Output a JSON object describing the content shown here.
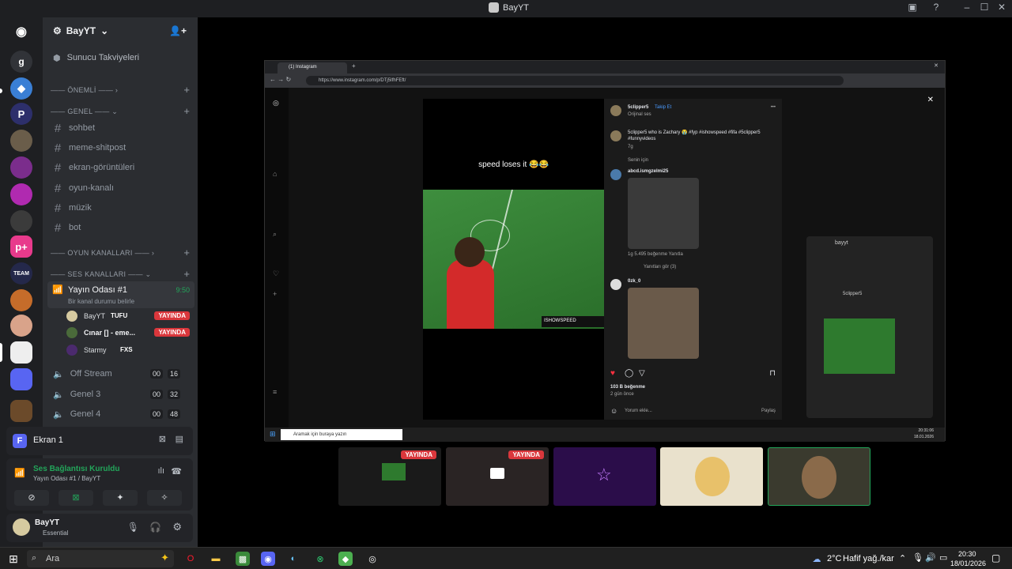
{
  "window": {
    "title": "BayYT"
  },
  "server": {
    "name": "BayYT",
    "boosts": "Sunucu Takviyeleri"
  },
  "categories": {
    "important": "ÖNEMLİ",
    "general": "GENEL",
    "game": "OYUN KANALLARI",
    "voice": "SES KANALLARI"
  },
  "text_channels": [
    "sohbet",
    "meme-shitpost",
    "ekran-görüntüleri",
    "oyun-kanalı",
    "müzik",
    "bot"
  ],
  "voice_active": {
    "name": "Yayın Odası #1",
    "timer": "9:50",
    "status_hint": "Bir kanal durumu belirle",
    "members": [
      {
        "name": "BayYT",
        "tag": "TUFU",
        "live": "YAYINDA"
      },
      {
        "name": "Cınar [] - eme...",
        "tag": "",
        "live": "YAYINDA"
      },
      {
        "name": "Starmy",
        "tag": "FXS",
        "live": ""
      }
    ]
  },
  "voice_channels": [
    {
      "name": "Off Stream",
      "a": "00",
      "b": "16"
    },
    {
      "name": "Genel 3",
      "a": "00",
      "b": "32"
    },
    {
      "name": "Genel 4",
      "a": "00",
      "b": "48"
    }
  ],
  "screen_panel": {
    "letter": "F",
    "label": "Ekran 1"
  },
  "connection": {
    "status": "Ses Bağlantısı Kuruldu",
    "detail": "Yayın Odası #1 / BayYT"
  },
  "user": {
    "name": "BayYT",
    "status": "Essential"
  },
  "browser": {
    "tab_title": "(1) Instagram",
    "url": "https://www.instagram.com/p/DTj5IfhFEft/"
  },
  "post": {
    "author": "5clipper5",
    "follow": "Takip Et",
    "audio": "Orijinal ses",
    "caption": "5clipper5 who is Zachary 😭 #fyp #ishowspeed #fifa #5clipper5 #funnyvideos",
    "caption_age": "7g",
    "sort": "Senin için",
    "video_caption": "speed loses it 😂😂",
    "watermark": "ISHOWSPEED",
    "comment1_user": "abcd.ismgzelmi25",
    "comment1_meta": "1g   5.495 beğenme   Yanıtla",
    "replies": "Yanıtları gör (3)",
    "comment2_user": "0zk_0",
    "likes": "103 B beğenme",
    "age": "2 gün önce",
    "comment_placeholder": "Yorum ekle...",
    "share": "Paylaş"
  },
  "popup": {
    "user": "bayyt",
    "user2": "5clipper5"
  },
  "inner_taskbar": {
    "search": "Aramak için buraya yazın",
    "time": "20:31:06",
    "date": "18.01.2026"
  },
  "stream_thumbs": [
    {
      "live": "YAYINDA"
    },
    {
      "live": "YAYINDA"
    }
  ],
  "taskbar": {
    "search": "Ara",
    "weather": "2°C",
    "weather_text": "Hafif yağ./kar",
    "time": "20:30",
    "date": "18/01/2026"
  }
}
